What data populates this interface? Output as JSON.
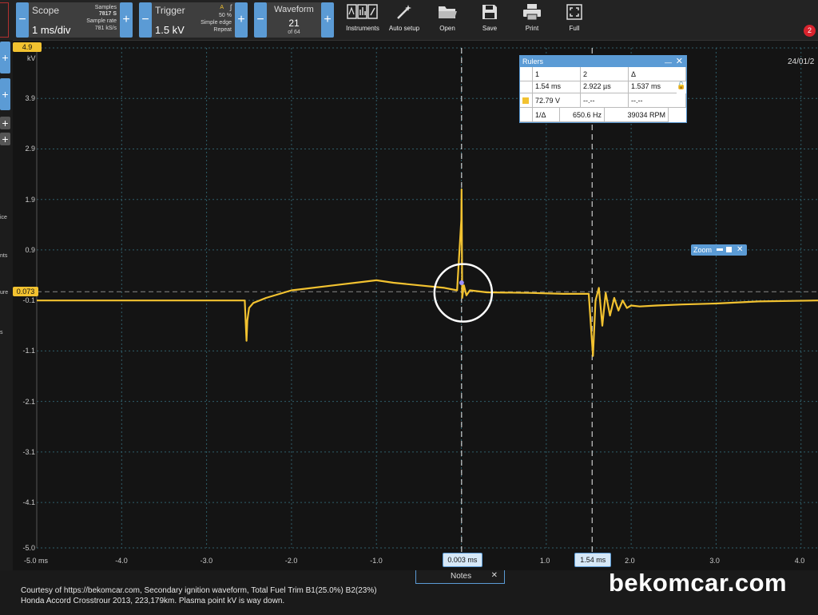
{
  "toolbar": {
    "scope": {
      "title": "Scope",
      "value": "1 ms/div",
      "samples_label": "Samples",
      "samples_value": "7817 S",
      "rate_label": "Sample rate",
      "rate_value": "781 kS/s"
    },
    "trigger": {
      "title": "Trigger",
      "value": "1.5 kV",
      "level": "50 %",
      "mode": "Simple edge",
      "repeat": "Repeat",
      "flag": "A"
    },
    "waveform": {
      "title": "Waveform",
      "current": "21",
      "total": "of 64"
    },
    "buttons": [
      {
        "label": "Instruments",
        "icon": "instruments-icon"
      },
      {
        "label": "Auto setup",
        "icon": "wand-icon"
      },
      {
        "label": "Open",
        "icon": "folder-icon"
      },
      {
        "label": "Save",
        "icon": "save-icon"
      },
      {
        "label": "Print",
        "icon": "printer-icon"
      },
      {
        "label": "Full",
        "icon": "fullscreen-icon"
      }
    ],
    "notifications": "2"
  },
  "axes": {
    "y_unit": "kV",
    "y_ticks": [
      "4.9",
      "3.9",
      "2.9",
      "1.9",
      "0.9",
      "-0.1",
      "-1.1",
      "-2.1",
      "-3.1",
      "-4.1",
      "-5.0"
    ],
    "x_ticks": [
      "-5.0 ms",
      "-4.0",
      "-3.0",
      "-2.0",
      "-1.0",
      "1.0",
      "2.0",
      "3.0",
      "4.0"
    ],
    "trigger_level_marker": "0.073"
  },
  "date": "24/01/2",
  "rulers": {
    "title": "Rulers",
    "columns": [
      "1",
      "2",
      "Δ"
    ],
    "time_row": [
      "1.54 ms",
      "2.922 µs",
      "1.537 ms"
    ],
    "voltage_row": [
      "72.79 V",
      "--.--",
      "--.--"
    ],
    "freq_row": {
      "label": "1/Δ",
      "hz": "650.6 Hz",
      "rpm": "39034 RPM"
    }
  },
  "zoom": {
    "label": "Zoom"
  },
  "markers": {
    "ruler1": "0.003 ms",
    "ruler2": "1.54 ms"
  },
  "notes": {
    "label": "Notes"
  },
  "left_fragments": [
    "ice",
    "nts",
    "ure",
    "s"
  ],
  "footer": {
    "credit_line1": "Courtesy of https://bekomcar.com, Secondary ignition waveform, Total Fuel Trim B1(25.0%) B2(23%)",
    "credit_line2": "Honda Accord Crosstrour 2013, 223,179km. Plasma point kV is way down.",
    "brand": "bekomcar.com"
  },
  "colors": {
    "trace": "#f2c230",
    "accent": "#5b9bd5",
    "background": "#141414",
    "grid": "#2f5e6a"
  },
  "chart_data": {
    "type": "line",
    "x_unit": "ms",
    "y_unit": "kV",
    "xlim": [
      -5.0,
      4.2
    ],
    "ylim": [
      -5.0,
      4.9
    ],
    "series": [
      {
        "x": [
          -5.0,
          -2.55,
          -2.53,
          -2.52,
          -2.5,
          -2.45,
          -2.3,
          -2.0,
          -1.5,
          -1.0,
          -0.8,
          -0.5,
          -0.2,
          -0.05,
          0.0,
          0.003,
          0.01,
          0.03,
          0.06,
          0.1,
          0.3,
          0.8,
          1.2,
          1.5,
          1.55,
          1.58,
          1.62,
          1.66,
          1.7,
          1.75,
          1.8,
          1.85,
          1.9,
          1.95,
          2.0,
          2.1,
          2.3,
          2.6,
          3.0,
          3.5,
          4.2
        ],
        "y": [
          -0.1,
          -0.1,
          -0.9,
          -0.5,
          -0.25,
          -0.15,
          -0.05,
          0.1,
          0.2,
          0.3,
          0.25,
          0.2,
          0.15,
          0.1,
          1.5,
          2.1,
          -0.05,
          0.2,
          0.0,
          0.1,
          0.06,
          0.05,
          0.03,
          0.03,
          -1.2,
          -0.1,
          0.15,
          -0.6,
          0.05,
          -0.4,
          -0.05,
          -0.3,
          -0.1,
          -0.25,
          -0.2,
          -0.22,
          -0.2,
          -0.18,
          -0.16,
          -0.12,
          -0.1
        ]
      }
    ]
  }
}
